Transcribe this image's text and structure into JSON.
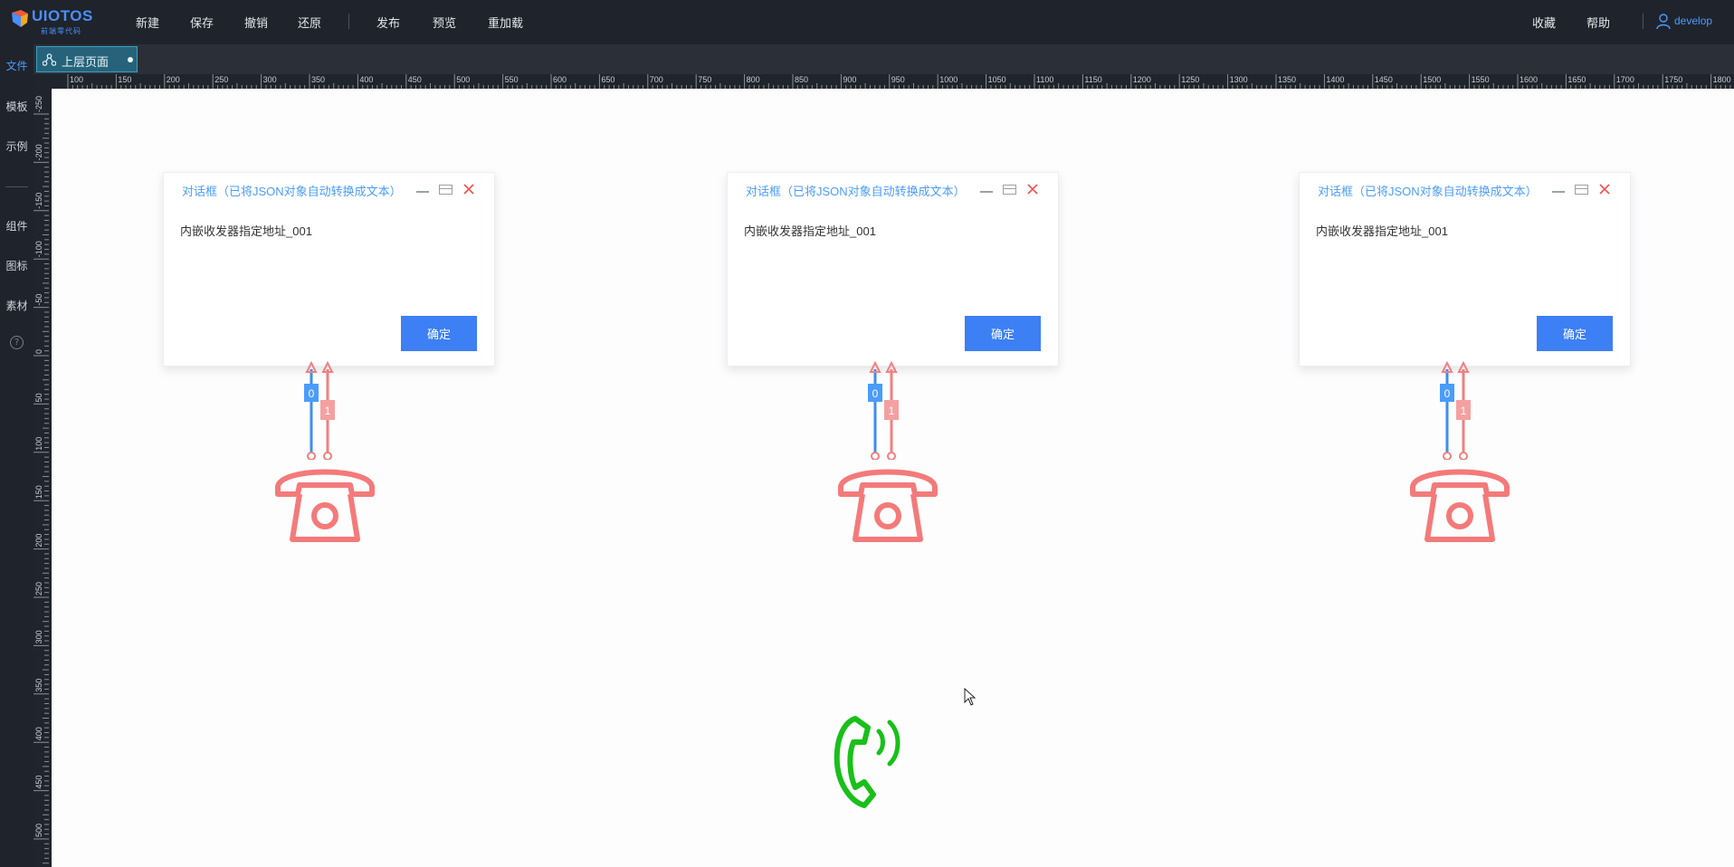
{
  "app": {
    "logo_text": "UIOTOS",
    "logo_sub": "前端零代码"
  },
  "toolbar": {
    "new_label": "新建",
    "save_label": "保存",
    "undo_label": "撤销",
    "redo_label": "还原",
    "publish_label": "发布",
    "preview_label": "预览",
    "reload_label": "重加载",
    "favorite_label": "收藏",
    "help_label": "帮助",
    "user_name": "develop"
  },
  "sidebar": {
    "items": [
      {
        "label": "文件",
        "active": true
      },
      {
        "label": "模板",
        "active": false
      },
      {
        "label": "示例",
        "active": false
      },
      {
        "label": "组件",
        "active": false
      },
      {
        "label": "图标",
        "active": false
      },
      {
        "label": "素材",
        "active": false
      }
    ],
    "help_icon": "?"
  },
  "tabs": [
    {
      "label": "上层页面",
      "icon": "tree-icon",
      "modified": true
    }
  ],
  "ruler": {
    "h_labels": [
      "100",
      "150",
      "200",
      "250",
      "300",
      "350",
      "400",
      "450",
      "500",
      "550",
      "600",
      "650",
      "700",
      "750",
      "800",
      "850",
      "900",
      "950",
      "1000",
      "1050",
      "1100",
      "1150",
      "1200",
      "1250",
      "1300",
      "1350",
      "1400",
      "1450",
      "1500",
      "1550",
      "1600",
      "1650",
      "1700",
      "1750",
      "1800"
    ],
    "v_labels": [
      "-250",
      "-200",
      "-150",
      "-100",
      "-50",
      "0",
      "50",
      "100",
      "150",
      "200",
      "250",
      "300",
      "350",
      "400",
      "450",
      "500"
    ]
  },
  "dialogs": [
    {
      "title": "对话框（已将JSON对象自动转换成文本）",
      "body": "内嵌收发器指定地址_001",
      "ok_label": "确定"
    },
    {
      "title": "对话框（已将JSON对象自动转换成文本）",
      "body": "内嵌收发器指定地址_001",
      "ok_label": "确定"
    },
    {
      "title": "对话框（已将JSON对象自动转换成文本）",
      "body": "内嵌收发器指定地址_001",
      "ok_label": "确定"
    }
  ],
  "connectors": {
    "port_labels": [
      "0",
      "1"
    ],
    "colors": {
      "blue": "#3d8ef0",
      "red": "#f08080"
    }
  },
  "colors": {
    "topbar_bg": "#1f232b",
    "accent": "#4a9cff",
    "button": "#3d7ff5",
    "phone_red": "#f47a7a",
    "phone_green": "#19c019"
  }
}
